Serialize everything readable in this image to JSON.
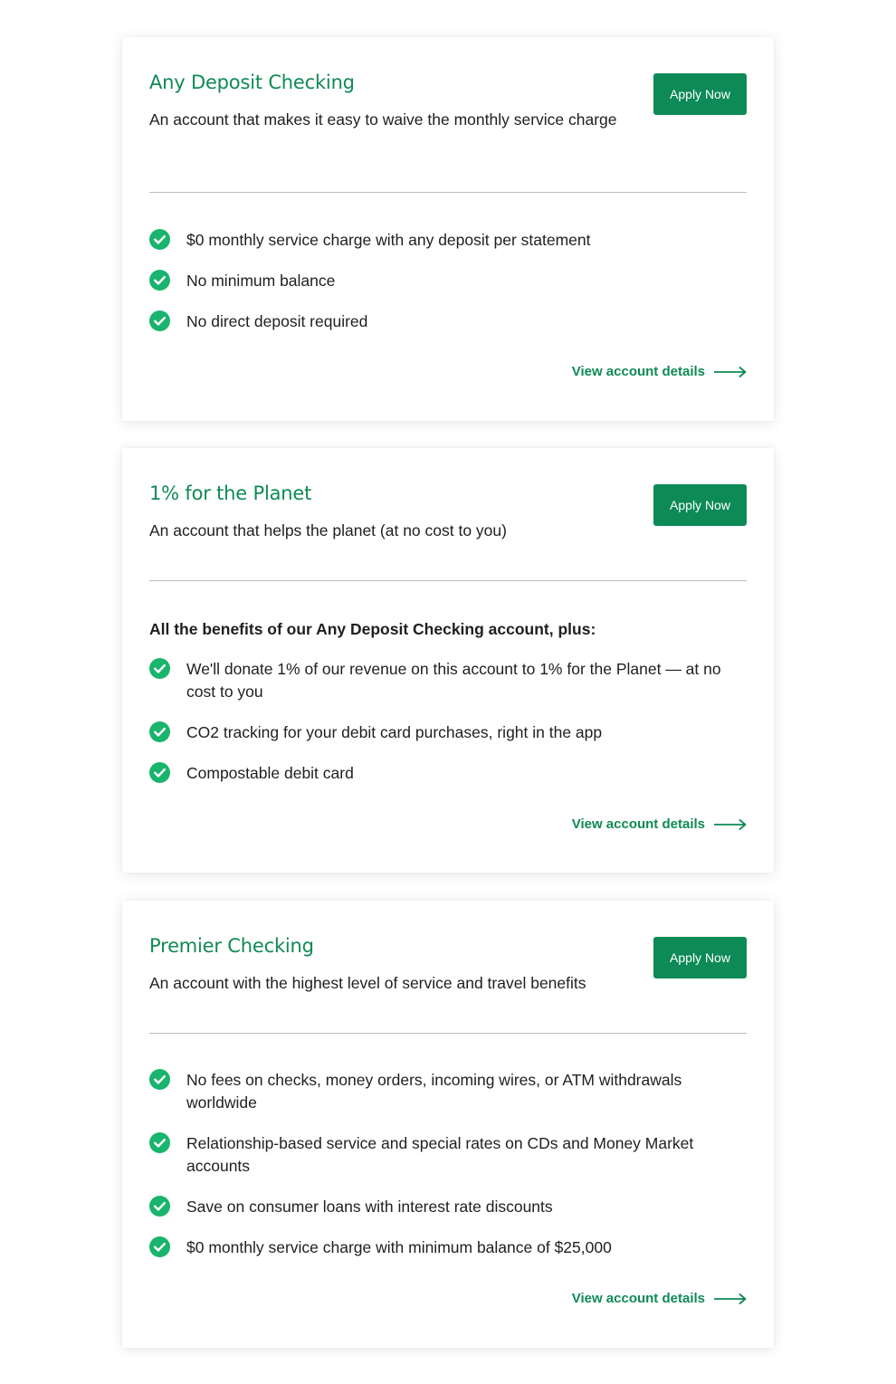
{
  "accounts": [
    {
      "title": "Any Deposit Checking",
      "description": "An account that makes it easy to waive the monthly service charge",
      "apply_label": "Apply Now",
      "intro": "",
      "features": [
        "$0 monthly service charge with any deposit per statement",
        "No minimum balance",
        "No direct deposit required"
      ],
      "details_label": "View account details"
    },
    {
      "title": "1% for the Planet",
      "description": "An account that helps the planet (at no cost to you)",
      "apply_label": "Apply Now",
      "intro": "All the benefits of our Any Deposit Checking account, plus:",
      "features": [
        "We'll donate 1% of our revenue on this account to 1% for the Planet — at no cost to you",
        "CO2 tracking for your debit card purchases, right in the app",
        "Compostable debit card"
      ],
      "details_label": "View account details"
    },
    {
      "title": "Premier Checking",
      "description": "An account with the highest level of service and travel benefits",
      "apply_label": "Apply Now",
      "intro": "",
      "features": [
        "No fees on checks, money orders, incoming wires, or ATM withdrawals worldwide",
        "Relationship-based service and special rates on CDs and Money Market accounts",
        "Save on consumer loans with interest rate discounts",
        "$0 monthly service charge with minimum balance of $25,000"
      ],
      "details_label": "View account details"
    }
  ],
  "icons": {
    "check": "check-circle-icon",
    "arrow": "arrow-right-icon"
  },
  "colors": {
    "brand_green": "#0f8a55",
    "button_green": "#0d8a56",
    "check_green": "#19b46d",
    "text": "#1f1f1f",
    "divider": "#bdbdbd"
  }
}
